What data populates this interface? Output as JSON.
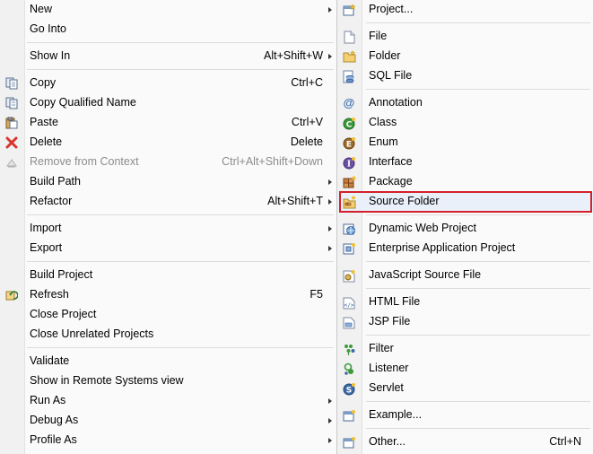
{
  "left_menu": {
    "items": [
      {
        "label": "New",
        "accel": "",
        "submenu": true,
        "icon": "",
        "disabled": false
      },
      {
        "label": "Go Into",
        "accel": "",
        "submenu": false,
        "icon": "",
        "disabled": false
      },
      {
        "label": "Show In",
        "accel": "Alt+Shift+W",
        "submenu": true,
        "icon": "",
        "disabled": false
      },
      {
        "label": "Copy",
        "accel": "Ctrl+C",
        "submenu": false,
        "icon": "copy-icon",
        "disabled": false
      },
      {
        "label": "Copy Qualified Name",
        "accel": "",
        "submenu": false,
        "icon": "copy-qualified-icon",
        "disabled": false
      },
      {
        "label": "Paste",
        "accel": "Ctrl+V",
        "submenu": false,
        "icon": "paste-icon",
        "disabled": false
      },
      {
        "label": "Delete",
        "accel": "Delete",
        "submenu": false,
        "icon": "delete-icon",
        "disabled": false
      },
      {
        "label": "Remove from Context",
        "accel": "Ctrl+Alt+Shift+Down",
        "submenu": false,
        "icon": "remove-context-icon",
        "disabled": true
      },
      {
        "label": "Build Path",
        "accel": "",
        "submenu": true,
        "icon": "",
        "disabled": false
      },
      {
        "label": "Refactor",
        "accel": "Alt+Shift+T",
        "submenu": true,
        "icon": "",
        "disabled": false
      },
      {
        "label": "Import",
        "accel": "",
        "submenu": true,
        "icon": "",
        "disabled": false
      },
      {
        "label": "Export",
        "accel": "",
        "submenu": true,
        "icon": "",
        "disabled": false
      },
      {
        "label": "Build Project",
        "accel": "",
        "submenu": false,
        "icon": "",
        "disabled": false
      },
      {
        "label": "Refresh",
        "accel": "F5",
        "submenu": false,
        "icon": "refresh-icon",
        "disabled": false
      },
      {
        "label": "Close Project",
        "accel": "",
        "submenu": false,
        "icon": "",
        "disabled": false
      },
      {
        "label": "Close Unrelated Projects",
        "accel": "",
        "submenu": false,
        "icon": "",
        "disabled": false
      },
      {
        "label": "Validate",
        "accel": "",
        "submenu": false,
        "icon": "",
        "disabled": false
      },
      {
        "label": "Show in Remote Systems view",
        "accel": "",
        "submenu": false,
        "icon": "",
        "disabled": false
      },
      {
        "label": "Run As",
        "accel": "",
        "submenu": true,
        "icon": "",
        "disabled": false
      },
      {
        "label": "Debug As",
        "accel": "",
        "submenu": true,
        "icon": "",
        "disabled": false
      },
      {
        "label": "Profile As",
        "accel": "",
        "submenu": true,
        "icon": "",
        "disabled": false
      }
    ]
  },
  "right_menu": {
    "items": [
      {
        "label": "Project...",
        "accel": "",
        "icon": "new-project-icon"
      },
      {
        "label": "File",
        "accel": "",
        "icon": "file-icon"
      },
      {
        "label": "Folder",
        "accel": "",
        "icon": "folder-icon"
      },
      {
        "label": "SQL File",
        "accel": "",
        "icon": "sql-file-icon"
      },
      {
        "label": "Annotation",
        "accel": "",
        "icon": "annotation-icon"
      },
      {
        "label": "Class",
        "accel": "",
        "icon": "class-icon"
      },
      {
        "label": "Enum",
        "accel": "",
        "icon": "enum-icon"
      },
      {
        "label": "Interface",
        "accel": "",
        "icon": "interface-icon"
      },
      {
        "label": "Package",
        "accel": "",
        "icon": "package-icon"
      },
      {
        "label": "Source Folder",
        "accel": "",
        "icon": "source-folder-icon"
      },
      {
        "label": "Dynamic Web Project",
        "accel": "",
        "icon": "web-project-icon"
      },
      {
        "label": "Enterprise Application Project",
        "accel": "",
        "icon": "ear-project-icon"
      },
      {
        "label": "JavaScript Source File",
        "accel": "",
        "icon": "javascript-file-icon"
      },
      {
        "label": "HTML File",
        "accel": "",
        "icon": "html-file-icon"
      },
      {
        "label": "JSP File",
        "accel": "",
        "icon": "jsp-file-icon"
      },
      {
        "label": "Filter",
        "accel": "",
        "icon": "filter-icon"
      },
      {
        "label": "Listener",
        "accel": "",
        "icon": "listener-icon"
      },
      {
        "label": "Servlet",
        "accel": "",
        "icon": "servlet-icon"
      },
      {
        "label": "Example...",
        "accel": "",
        "icon": "example-icon"
      },
      {
        "label": "Other...",
        "accel": "Ctrl+N",
        "icon": "other-icon"
      }
    ],
    "highlighted": "Source Folder"
  },
  "colors": {
    "highlight_border": "#d3202a",
    "delete_red": "#d9342b",
    "class_green": "#3c9a3c",
    "enum_brown": "#9b6a2a",
    "interface_purple": "#6a4fa3"
  }
}
